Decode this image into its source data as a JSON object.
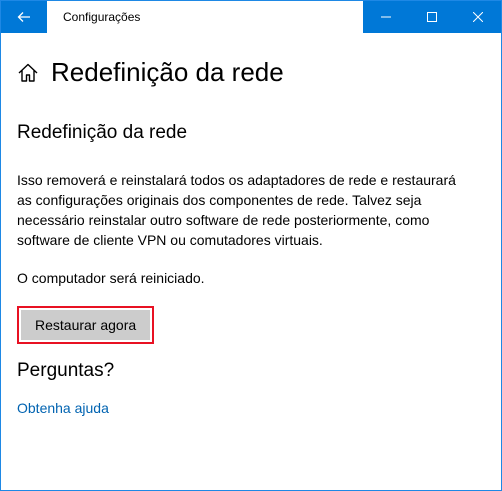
{
  "window": {
    "title": "Configurações",
    "accent": "#0078d7"
  },
  "page": {
    "title": "Redefinição da rede",
    "home_icon": "home-icon"
  },
  "section": {
    "title": "Redefinição da rede",
    "description": "Isso removerá e reinstalará todos os adaptadores de rede e restaurará as configurações originais dos componentes de rede. Talvez seja necessário reinstalar outro software de rede posteriormente, como software de cliente VPN ou comutadores virtuais.",
    "restart_note": "O computador será reiniciado.",
    "button_label": "Restaurar agora",
    "highlight_color": "#e81123"
  },
  "questions": {
    "title": "Perguntas?",
    "link": "Obtenha ajuda"
  }
}
